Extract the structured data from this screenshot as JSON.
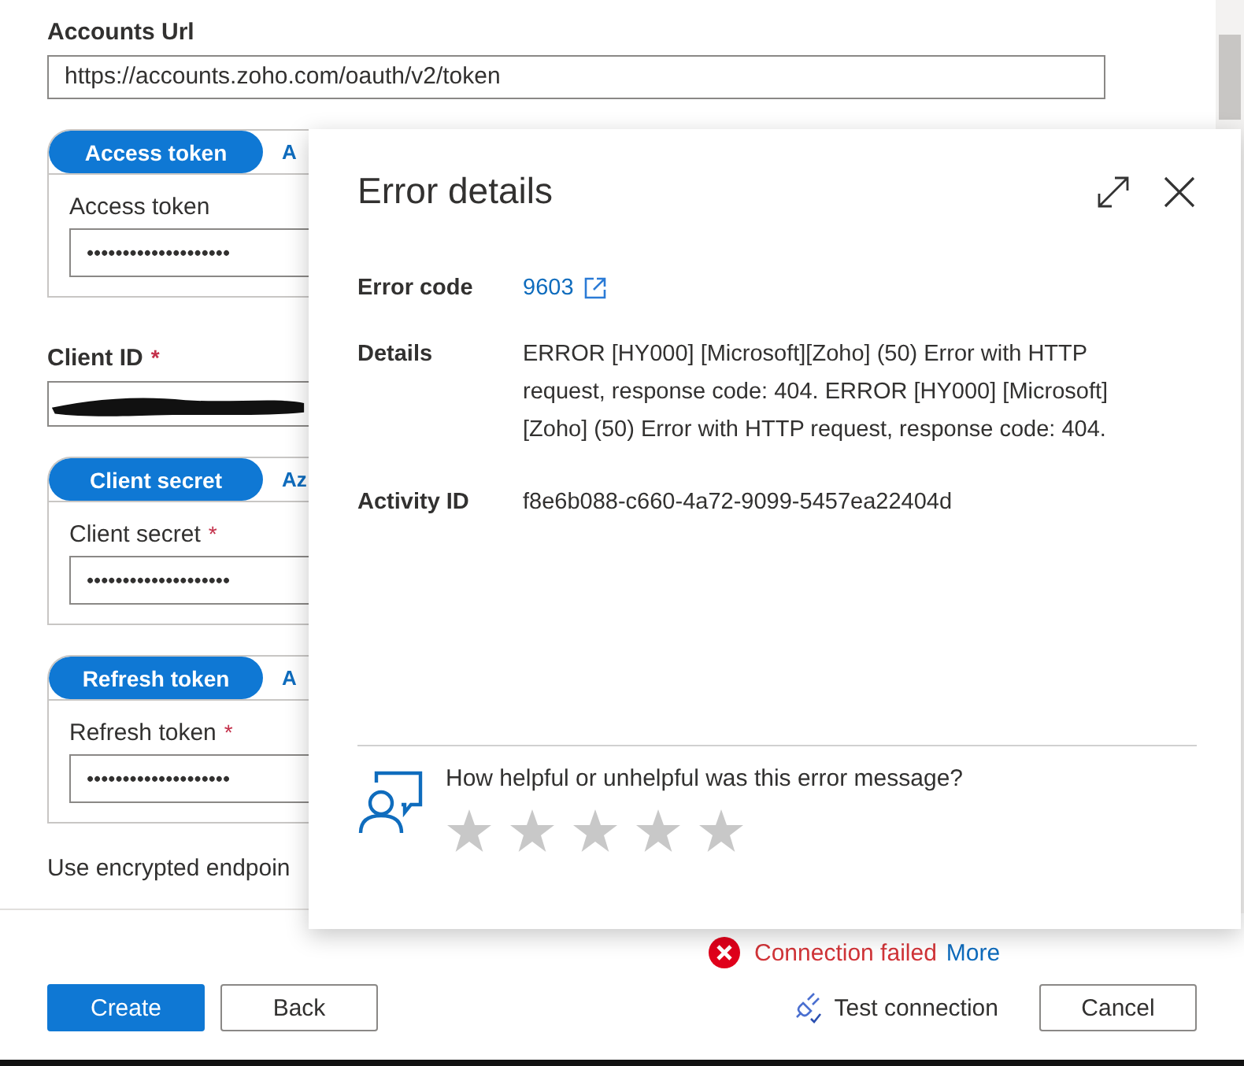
{
  "form": {
    "accounts_url": {
      "label": "Accounts Url",
      "value": "https://accounts.zoho.com/oauth/v2/token"
    },
    "sections": [
      {
        "kind": "secret",
        "tabs": [
          {
            "label": "Access token",
            "selected": true
          },
          {
            "label": "A",
            "selected": false
          }
        ],
        "field": {
          "label": "Access token",
          "value": "••••••••••••••••••••"
        }
      },
      {
        "kind": "plain",
        "field": {
          "label": "Client ID",
          "required_mark": "*",
          "redacted": true
        }
      },
      {
        "kind": "secret",
        "tabs": [
          {
            "label": "Client secret",
            "selected": true
          },
          {
            "label": "Az",
            "selected": false
          }
        ],
        "field": {
          "label": "Client secret",
          "required_mark": "*",
          "value": "••••••••••••••••••••"
        }
      },
      {
        "kind": "secret",
        "tabs": [
          {
            "label": "Refresh token",
            "selected": true
          },
          {
            "label": "A",
            "selected": false
          }
        ],
        "field": {
          "label": "Refresh token",
          "required_mark": "*",
          "value": "••••••••••••••••••••"
        }
      }
    ],
    "encrypted_endpoint": {
      "label": "Use encrypted endpoin"
    }
  },
  "status": {
    "text": "Connection failed",
    "link": "More"
  },
  "buttons": [
    {
      "label": "Create",
      "kind": "primary"
    },
    {
      "label": "Back",
      "kind": "default"
    },
    {
      "label": "Test connection",
      "kind": "icon"
    },
    {
      "label": "Cancel",
      "kind": "default"
    }
  ],
  "error_panel": {
    "title": "Error details",
    "rows": [
      {
        "label": "Error code",
        "value": "9603",
        "kind": "link"
      },
      {
        "label": "Details",
        "value": "ERROR [HY000] [Microsoft][Zoho] (50) Error with HTTP request, response code: 404. ERROR [HY000] [Microsoft][Zoho] (50) Error with HTTP request, response code: 404.",
        "kind": "text"
      },
      {
        "label": "Activity ID",
        "value": "f8e6b088-c660-4a72-9099-5457ea22404d",
        "kind": "text"
      }
    ],
    "feedback": {
      "question": "How helpful or unhelpful was this error message?",
      "stars": 0
    }
  }
}
